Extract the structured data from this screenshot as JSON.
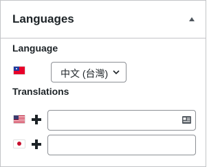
{
  "panel": {
    "title": "Languages",
    "collapse_icon": "triangle-up-icon"
  },
  "language": {
    "label": "Language",
    "flag": "taiwan-flag-icon",
    "selected": "中文 (台灣)"
  },
  "translations": {
    "label": "Translations",
    "rows": [
      {
        "flag": "us-flag-icon",
        "add_icon": "plus-icon",
        "value": "",
        "field_icon": "id-card-icon"
      },
      {
        "flag": "japan-flag-icon",
        "add_icon": "plus-icon",
        "value": ""
      }
    ]
  },
  "colors": {
    "border": "#c3c4c7",
    "input_border": "#8c8f94",
    "text": "#1d2327"
  }
}
